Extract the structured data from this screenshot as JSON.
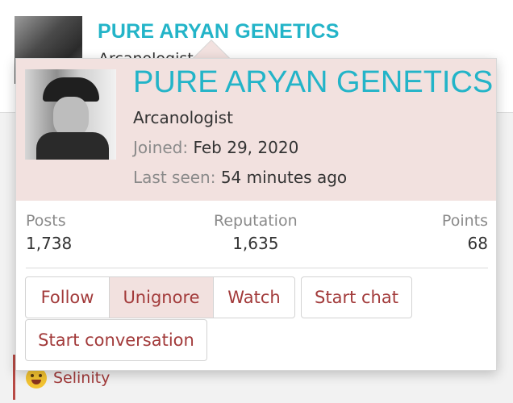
{
  "background": {
    "title": "PURE ARYAN GENETICS",
    "subtitle": "Arcanologist",
    "lower_user": "Selinity"
  },
  "popup": {
    "username": "PURE ARYAN GENETICS",
    "user_title": "Arcanologist",
    "joined_label": "Joined:",
    "joined_value": "Feb 29, 2020",
    "last_seen_label": "Last seen:",
    "last_seen_value": "54 minutes ago",
    "stats": {
      "posts_label": "Posts",
      "posts_value": "1,738",
      "reputation_label": "Reputation",
      "reputation_value": "1,635",
      "points_label": "Points",
      "points_value": "68"
    },
    "buttons": {
      "follow": "Follow",
      "unignore": "Unignore",
      "watch": "Watch",
      "start_chat": "Start chat",
      "start_conversation": "Start conversation"
    }
  },
  "colors": {
    "username": "#23b4c8",
    "header_bg": "#f2e1df",
    "button_text": "#a23a3a"
  }
}
